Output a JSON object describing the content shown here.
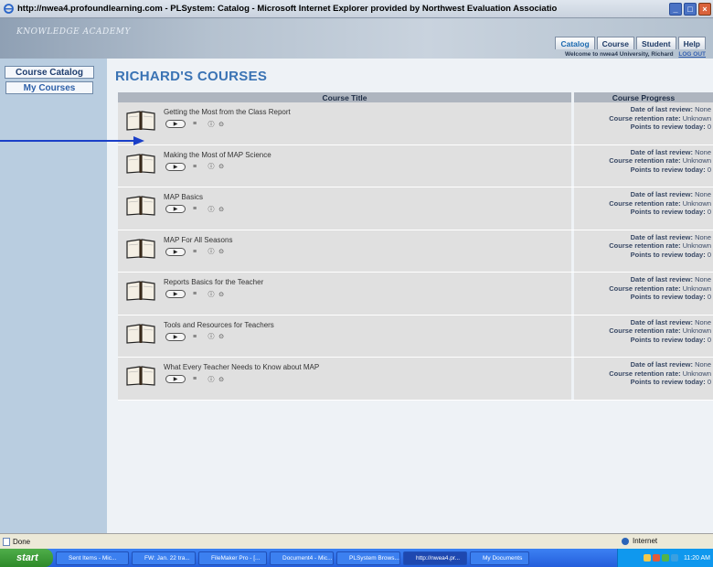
{
  "window": {
    "title": "http://nwea4.profoundlearning.com - PLSystem: Catalog - Microsoft Internet Explorer provided by Northwest Evaluation Associatio"
  },
  "header": {
    "logo": "KNOWLEDGE ACADEMY",
    "tabs": [
      {
        "label": "Catalog",
        "active": true
      },
      {
        "label": "Course",
        "active": false
      },
      {
        "label": "Student",
        "active": false
      },
      {
        "label": "Help",
        "active": false
      }
    ],
    "welcome": "Welcome to nwea4 University, Richard",
    "logout": "LOG OUT"
  },
  "sidebar": {
    "course_catalog": "Course Catalog",
    "my_courses": "My Courses"
  },
  "main": {
    "title": "RICHARD'S COURSES",
    "col_title": "Course Title",
    "col_progress": "Course Progress",
    "progress_labels": {
      "last_review": "Date of last review:",
      "retention": "Course retention rate:",
      "points": "Points to review today:"
    },
    "courses": [
      {
        "name": "Getting the Most from the Class Report",
        "last_review": "None",
        "retention": "Unknown",
        "points": "0"
      },
      {
        "name": "Making the Most of MAP Science",
        "last_review": "None",
        "retention": "Unknown",
        "points": "0"
      },
      {
        "name": "MAP Basics",
        "last_review": "None",
        "retention": "Unknown",
        "points": "0"
      },
      {
        "name": "MAP For All Seasons",
        "last_review": "None",
        "retention": "Unknown",
        "points": "0"
      },
      {
        "name": "Reports Basics for the Teacher",
        "last_review": "None",
        "retention": "Unknown",
        "points": "0"
      },
      {
        "name": "Tools and Resources for Teachers",
        "last_review": "None",
        "retention": "Unknown",
        "points": "0"
      },
      {
        "name": "What Every Teacher Needs to Know about MAP",
        "last_review": "None",
        "retention": "Unknown",
        "points": "0"
      }
    ]
  },
  "statusbar": {
    "status": "Done",
    "zone": "Internet"
  },
  "taskbar": {
    "start": "start",
    "tasks": [
      "Sent Items - Mic...",
      "FW: Jan. 22 tra...",
      "FileMaker Pro - [...",
      "Document4 - Mic...",
      "PLSystem Brows...",
      "http://nwea4.pr...",
      "My Documents"
    ],
    "active_task_index": 5,
    "clock": "11:20 AM"
  },
  "colors": {
    "sidebar_bg": "#b9cde0",
    "title_blue": "#3a73b4",
    "row_bg": "#e0e0e0",
    "arrow": "#1a3fc8"
  }
}
